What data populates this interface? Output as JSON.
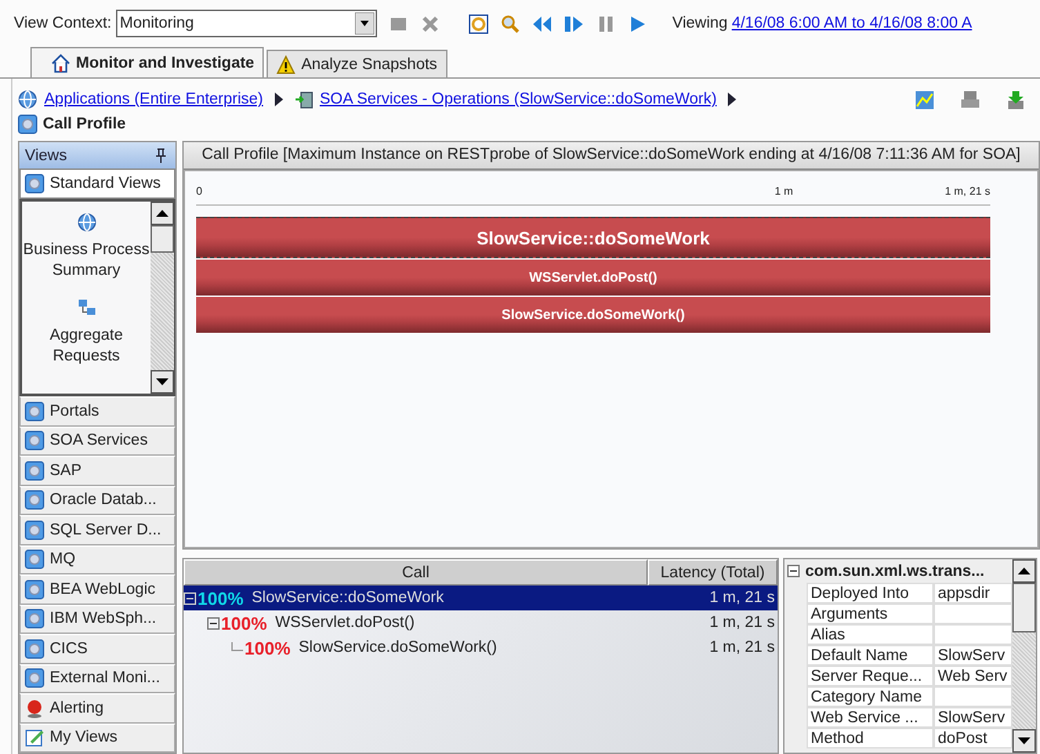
{
  "toolbar": {
    "view_context_label": "View Context:",
    "view_context_value": "Monitoring",
    "viewing_label": "Viewing",
    "viewing_range": "4/16/08 6:00 AM to 4/16/08 8:00 A"
  },
  "tabs": [
    {
      "label": "Monitor and Investigate",
      "selected": true
    },
    {
      "label": "Analyze Snapshots",
      "selected": false
    }
  ],
  "breadcrumb": [
    {
      "label": "Applications (Entire Enterprise)"
    },
    {
      "label": "SOA Services - Operations (SlowService::doSomeWork)"
    }
  ],
  "page_title": "Call Profile",
  "sidebar": {
    "title": "Views",
    "sections": [
      {
        "label": "Standard Views",
        "kind": "view",
        "expanded": true,
        "items": [
          {
            "label": "Business Process Summary"
          },
          {
            "label": "Aggregate Requests"
          }
        ]
      },
      {
        "label": "Portals",
        "kind": "view",
        "expanded": false
      },
      {
        "label": "SOA Services",
        "kind": "view",
        "expanded": false
      },
      {
        "label": "SAP",
        "kind": "view",
        "expanded": false
      },
      {
        "label": "Oracle Datab...",
        "kind": "view",
        "expanded": false
      },
      {
        "label": "SQL Server D...",
        "kind": "view",
        "expanded": false
      },
      {
        "label": "MQ",
        "kind": "view",
        "expanded": false
      },
      {
        "label": "BEA WebLogic",
        "kind": "view",
        "expanded": false
      },
      {
        "label": "IBM WebSph...",
        "kind": "view",
        "expanded": false
      },
      {
        "label": "CICS",
        "kind": "view",
        "expanded": false
      },
      {
        "label": "External Moni...",
        "kind": "view",
        "expanded": false
      },
      {
        "label": "Alerting",
        "kind": "alert",
        "expanded": false
      },
      {
        "label": "My Views",
        "kind": "edit",
        "expanded": false
      }
    ]
  },
  "profile_panel": {
    "title": "Call Profile [Maximum Instance on RESTprobe of SlowService::doSomeWork ending at 4/16/08 7:11:36 AM for SOA]",
    "ticks": [
      "0",
      "1 m",
      "1 m, 21 s"
    ],
    "bars": [
      {
        "label": "SlowService::doSomeWork",
        "selected": true
      },
      {
        "label": "WSServlet.doPost()",
        "selected": false
      },
      {
        "label": "SlowService.doSomeWork()",
        "selected": false
      }
    ]
  },
  "call_table": {
    "columns": [
      "Call",
      "Latency (Total)"
    ],
    "rows": [
      {
        "percent": "100%",
        "call": "SlowService::doSomeWork",
        "latency": "1 m, 21 s",
        "selected": true,
        "children": [
          {
            "percent": "100%",
            "call": "WSServlet.doPost()",
            "latency": "1 m, 21 s",
            "selected": false,
            "children": [
              {
                "percent": "100%",
                "call": "SlowService.doSomeWork()",
                "latency": "1 m, 21 s",
                "selected": false
              }
            ]
          }
        ]
      }
    ]
  },
  "properties": {
    "group": "com.sun.xml.ws.trans...",
    "rows": [
      {
        "name": "Deployed Into",
        "value": "appsdir"
      },
      {
        "name": "Arguments"
      },
      {
        "name": "Alias"
      },
      {
        "name": "Default Name",
        "value": "SlowServ"
      },
      {
        "name": "Server Reque...",
        "value": "Web Serv"
      },
      {
        "name": "Category Name"
      },
      {
        "name": "Web Service ...",
        "value": "SlowServ"
      },
      {
        "name": "Method",
        "value": "doPost"
      }
    ]
  }
}
